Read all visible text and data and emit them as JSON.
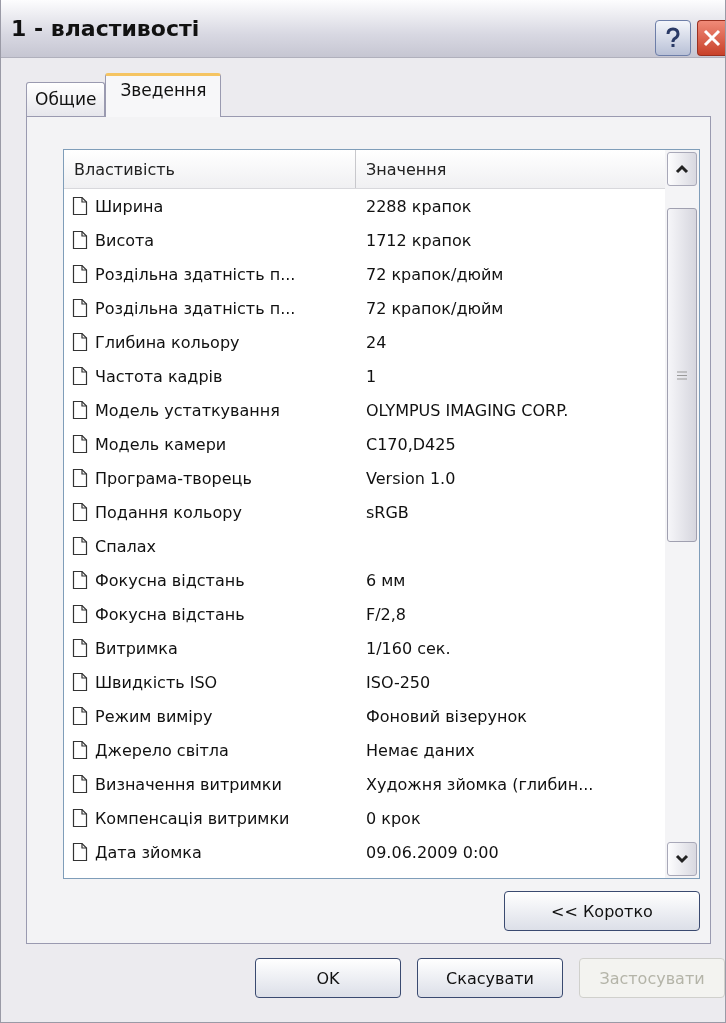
{
  "window": {
    "title": "1 - властивості"
  },
  "tabs": [
    {
      "label": "Общие",
      "selected": false
    },
    {
      "label": "Зведення",
      "selected": true
    }
  ],
  "table": {
    "columns": [
      "Властивість",
      "Значення"
    ],
    "rows": [
      {
        "name": "Ширина",
        "value": "2288 крапок"
      },
      {
        "name": "Висота",
        "value": "1712 крапок"
      },
      {
        "name": "Роздільна здатність п...",
        "value": "72 крапок/дюйм"
      },
      {
        "name": "Роздільна здатність п...",
        "value": "72 крапок/дюйм"
      },
      {
        "name": "Глибина кольору",
        "value": "24"
      },
      {
        "name": "Частота кадрів",
        "value": "1"
      },
      {
        "name": "Модель устаткування",
        "value": "OLYMPUS IMAGING CORP."
      },
      {
        "name": "Модель камери",
        "value": "C170,D425"
      },
      {
        "name": "Програма-творець",
        "value": "Version 1.0"
      },
      {
        "name": "Подання кольору",
        "value": "sRGB"
      },
      {
        "name": "Спалах"
      },
      {
        "name": "Фокусна відстань",
        "value": "6 мм"
      },
      {
        "name": "Фокусна відстань",
        "value": "F/2,8"
      },
      {
        "name": "Витримка",
        "value": "1/160 сек."
      },
      {
        "name": "Швидкість ISO",
        "value": "ISO-250"
      },
      {
        "name": "Режим виміру",
        "value": "Фоновий візерунок"
      },
      {
        "name": "Джерело світла",
        "value": "Немає даних"
      },
      {
        "name": "Визначення витримки",
        "value": "Художня зйомка (глибин..."
      },
      {
        "name": "Компенсація витримки",
        "value": "0 крок"
      },
      {
        "name": "Дата зйомка",
        "value": "09.06.2009 0:00"
      }
    ]
  },
  "summary_button": "<< Коротко",
  "buttons": [
    {
      "label": "OK",
      "disabled": false
    },
    {
      "label": "Скасувати",
      "disabled": false
    },
    {
      "label": "Застосувати",
      "disabled": true
    }
  ]
}
